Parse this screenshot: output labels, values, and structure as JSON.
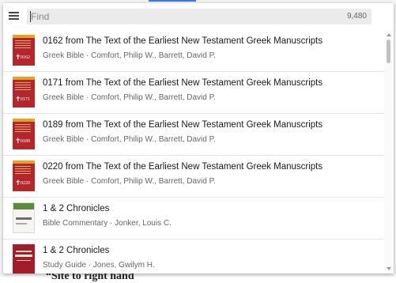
{
  "search": {
    "placeholder": "Find",
    "result_count": "9,480"
  },
  "background": {
    "partial_text": "“Site to right hand"
  },
  "results": [
    {
      "title": "0162 from The Text of the Earliest New Testament Greek Manuscripts",
      "subtitle": "Greek Bible · Comfort, Philip W., Barrett, David P.",
      "cover": "red",
      "cover_code": "0162"
    },
    {
      "title": "0171 from The Text of the Earliest New Testament Greek Manuscripts",
      "subtitle": "Greek Bible · Comfort, Philip W., Barrett, David P.",
      "cover": "red",
      "cover_code": "0171"
    },
    {
      "title": "0189 from The Text of the Earliest New Testament Greek Manuscripts",
      "subtitle": "Greek Bible · Comfort, Philip W., Barrett, David P.",
      "cover": "red",
      "cover_code": "0189"
    },
    {
      "title": "0220 from The Text of the Earliest New Testament Greek Manuscripts",
      "subtitle": "Greek Bible · Comfort, Philip W., Barrett, David P.",
      "cover": "red",
      "cover_code": "0220"
    },
    {
      "title": "1 & 2 Chronicles",
      "subtitle": "Bible Commentary · Jonker, Louis C.",
      "cover": "white"
    },
    {
      "title": "1 & 2 Chronicles",
      "subtitle": "Study Guide · Jones, Gwilym H.",
      "cover": "crimson"
    }
  ],
  "colors": {
    "accent": "#3b78e7",
    "cover_red": "#b3272c",
    "cover_gold": "#e0a526",
    "cover_crimson": "#a11d2b"
  },
  "icons": {
    "menu": "hamburger-menu-icon",
    "scroll_up": "chevron-up-icon",
    "scroll_down": "chevron-down-icon"
  }
}
